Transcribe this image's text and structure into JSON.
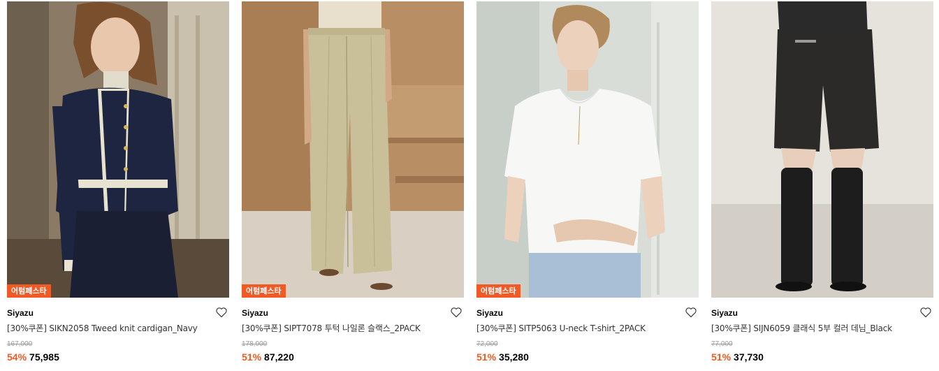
{
  "colors": {
    "accent": "#f15a24",
    "text": "#000000",
    "muted": "#9a9a9a"
  },
  "products": [
    {
      "badge": "어텀페스타",
      "brand": "Siyazu",
      "title": "[30%쿠폰] SIKN2058 Tweed knit cardigan_Navy",
      "original_price": "167,000",
      "discount": "54%",
      "price": "75,985",
      "image": "woman-navy-tweed-cardigan",
      "like_icon": "heart-outline-icon"
    },
    {
      "badge": "어텀페스타",
      "brand": "Siyazu",
      "title": "[30%쿠폰] SIPT7078 투턱 나일론 슬랙스_2PACK",
      "original_price": "178,000",
      "discount": "51%",
      "price": "87,220",
      "image": "beige-wide-slacks",
      "like_icon": "heart-outline-icon"
    },
    {
      "badge": "어텀페스타",
      "brand": "Siyazu",
      "title": "[30%쿠폰] SITP5063 U-neck T-shirt_2PACK",
      "original_price": "72,000",
      "discount": "51%",
      "price": "35,280",
      "image": "woman-white-tshirt",
      "like_icon": "heart-outline-icon"
    },
    {
      "badge": "",
      "brand": "Siyazu",
      "title": "[30%쿠폰] SIJN6059 클래식 5부 컬러 데님_Black",
      "original_price": "77,000",
      "discount": "51%",
      "price": "37,730",
      "image": "black-denim-shorts-boots",
      "like_icon": "heart-outline-icon"
    }
  ]
}
